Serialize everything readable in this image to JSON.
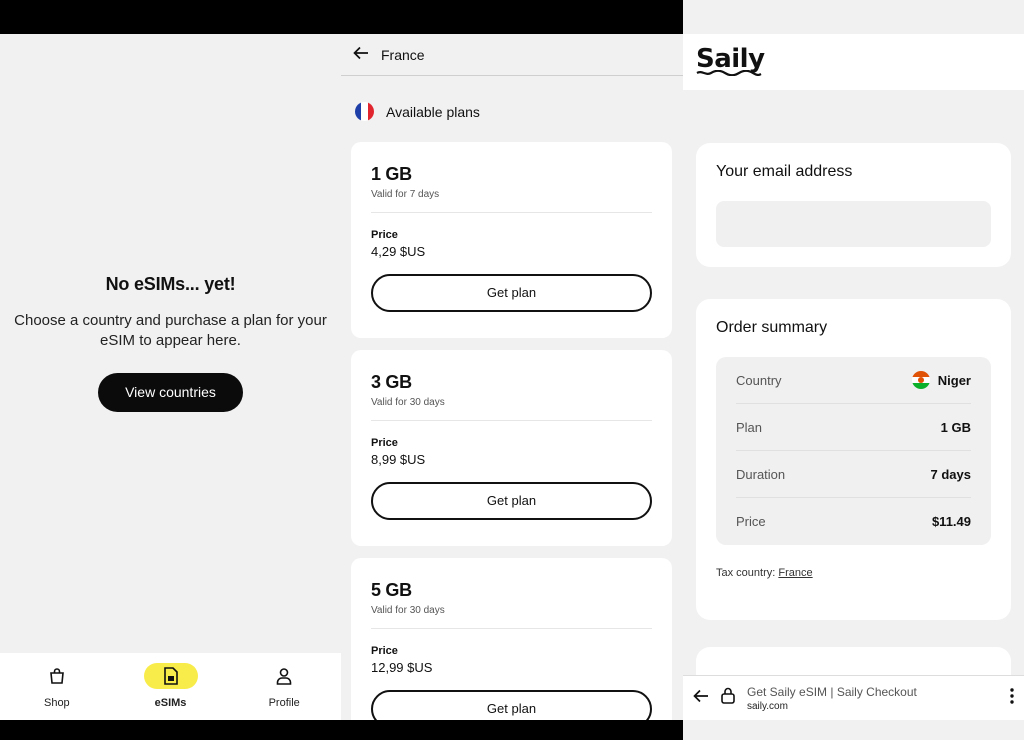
{
  "esims_screen": {
    "empty_title": "No eSIMs... yet!",
    "empty_message": "Choose a country and purchase a plan for your eSIM to appear here.",
    "view_countries_label": "View countries",
    "nav": [
      {
        "label": "Shop",
        "icon": "shopping-bag-icon"
      },
      {
        "label": "eSIMs",
        "icon": "sim-card-icon",
        "active": true
      },
      {
        "label": "Profile",
        "icon": "person-icon"
      }
    ],
    "accent_color": "#f8ec4a"
  },
  "country_screen": {
    "country_title": "France",
    "section_title": "Available plans",
    "plans": [
      {
        "data": "1 GB",
        "validity": "Valid for 7 days",
        "price_label": "Price",
        "price": "4,29 $US",
        "button": "Get plan"
      },
      {
        "data": "3 GB",
        "validity": "Valid for 30 days",
        "price_label": "Price",
        "price": "8,99 $US",
        "button": "Get plan"
      },
      {
        "data": "5 GB",
        "validity": "Valid for 30 days",
        "price_label": "Price",
        "price": "12,99 $US",
        "button": "Get plan"
      }
    ]
  },
  "checkout_screen": {
    "logo": "Saily",
    "email_title": "Your email address",
    "summary_title": "Order summary",
    "summary": [
      {
        "key": "Country",
        "value": "Niger"
      },
      {
        "key": "Plan",
        "value": "1 GB"
      },
      {
        "key": "Duration",
        "value": "7 days"
      },
      {
        "key": "Price",
        "value": "$11.49"
      }
    ],
    "tax_label": "Tax country:",
    "tax_country": "France",
    "browser": {
      "page_title": "Get Saily eSIM | Saily Checkout",
      "url": "saily.com"
    }
  }
}
